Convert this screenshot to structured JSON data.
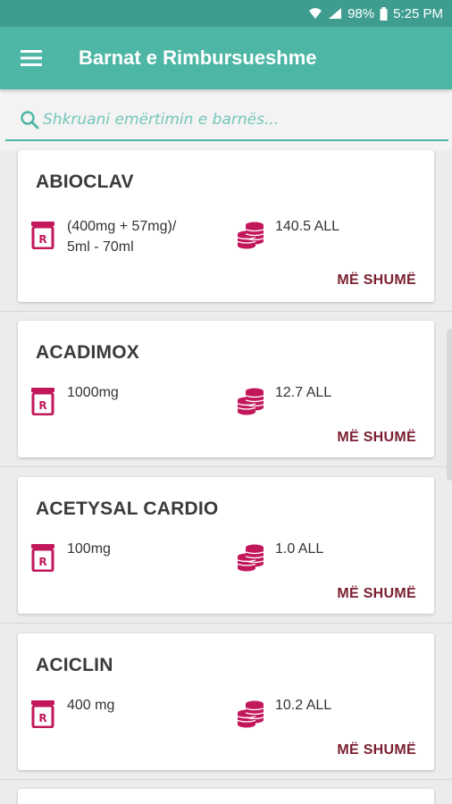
{
  "status_bar": {
    "battery": "98%",
    "time": "5:25 PM"
  },
  "app_bar": {
    "title": "Barnat e Rimbursueshme"
  },
  "search": {
    "placeholder": "Shkruani emërtimin e barnës..."
  },
  "medications": [
    {
      "name": "ABIOCLAV",
      "dose": "(400mg + 57mg)/\n5ml - 70ml",
      "price": "140.5 ALL",
      "more_label": "MË SHUMË"
    },
    {
      "name": "ACADIMOX",
      "dose": "1000mg",
      "price": "12.7 ALL",
      "more_label": "MË SHUMË"
    },
    {
      "name": "ACETYSAL CARDIO",
      "dose": "100mg",
      "price": "1.0 ALL",
      "more_label": "MË SHUMË"
    },
    {
      "name": "ACICLIN",
      "dose": "400 mg",
      "price": "10.2 ALL",
      "more_label": "MË SHUMË"
    }
  ],
  "colors": {
    "status_bar": "#3e9d8f",
    "app_bar": "#4db6a5",
    "accent": "#4db6a5",
    "icon": "#c2185b",
    "more_button": "#7b1f30"
  },
  "icons": {
    "menu": "hamburger-icon",
    "search": "search-icon",
    "dose": "prescription-bottle-icon",
    "price": "coins-icon"
  }
}
